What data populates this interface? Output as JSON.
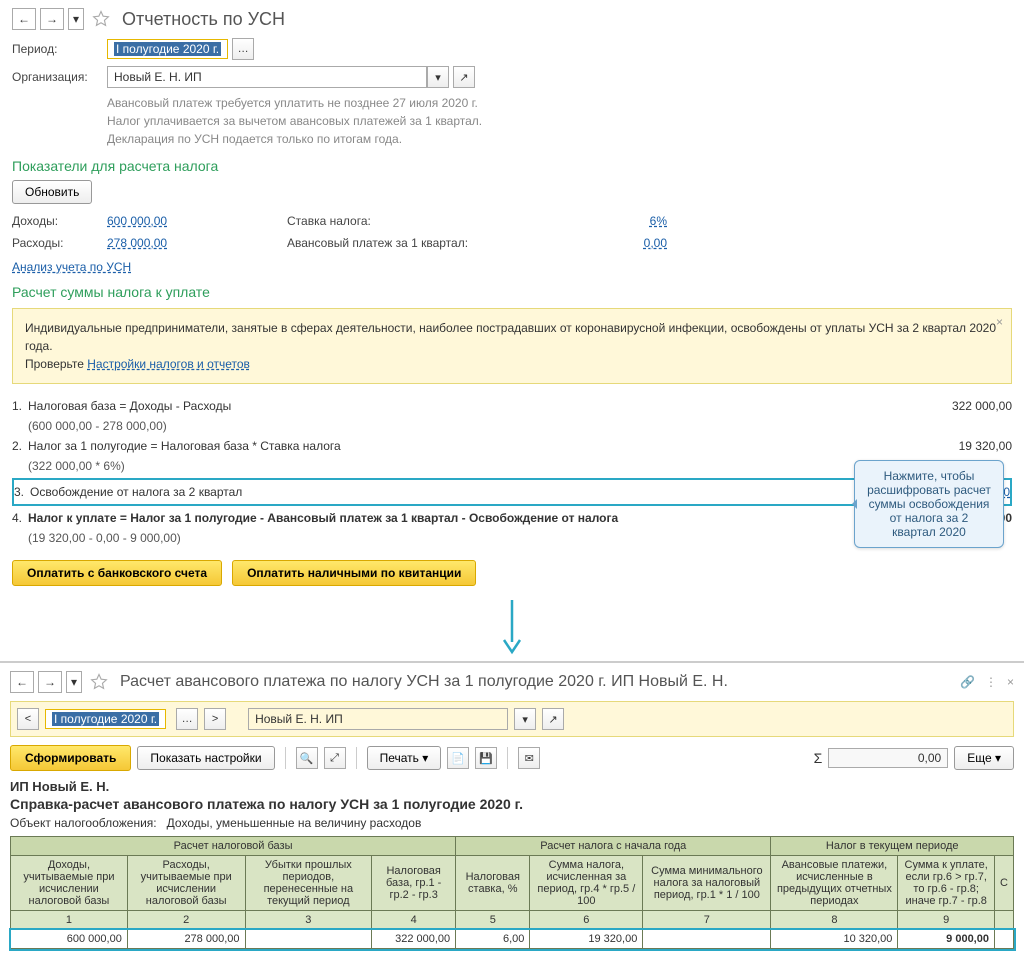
{
  "screen1": {
    "title": "Отчетность по УСН",
    "period_label": "Период:",
    "period_value": "I полугодие 2020 г.",
    "org_label": "Организация:",
    "org_value": "Новый Е. Н. ИП",
    "info_line1": "Авансовый платеж требуется уплатить не позднее 27 июля 2020 г.",
    "info_line2": "Налог уплачивается за вычетом авансовых платежей за 1 квартал.",
    "info_line3": "Декларация по УСН подается только по итогам года.",
    "section_indicators": "Показатели для расчета налога",
    "refresh_btn": "Обновить",
    "income_label": "Доходы:",
    "income_value": "600 000,00",
    "rate_label": "Ставка налога:",
    "rate_value": "6%",
    "expense_label": "Расходы:",
    "expense_value": "278 000,00",
    "advance_label": "Авансовый платеж за 1 квартал:",
    "advance_value": "0,00",
    "analysis_link": "Анализ учета по УСН",
    "section_calc": "Расчет суммы налога к уплате",
    "warning_line1": "Индивидуальные предприниматели, занятые в сферах деятельности, наиболее пострадавших от коронавирусной инфекции, освобождены от уплаты УСН за 2 квартал 2020 года.",
    "warning_line2_prefix": "Проверьте ",
    "warning_link": "Настройки налогов и отчетов",
    "calc": {
      "r1_text": "Налоговая база = Доходы - Расходы",
      "r1_sub": "(600 000,00 - 278 000,00)",
      "r1_amount": "322 000,00",
      "r2_text": "Налог за 1 полугодие = Налоговая база * Ставка налога",
      "r2_sub": "(322 000,00 * 6%)",
      "r2_amount": "19 320,00",
      "r3_text": "Освобождение от налога за 2 квартал",
      "r3_amount": "9 000,00",
      "r4_text": "Налог к уплате = Налог за 1 полугодие - Авансовый платеж за 1 квартал - Освобождение от налога",
      "r4_sub": "(19 320,00 - 0,00 - 9 000,00)",
      "r4_amount": "19 320,00"
    },
    "btn_pay_bank": "Оплатить с банковского счета",
    "btn_pay_cash": "Оплатить наличными по квитанции",
    "callout": "Нажмите, чтобы расшифровать расчет суммы освобождения от налога за 2 квартал 2020"
  },
  "screen2": {
    "title": "Расчет  авансового платежа по налогу УСН за 1 полугодие 2020 г. ИП Новый Е. Н.",
    "period_value": "I полугодие 2020 г.",
    "org_value": "Новый Е. Н. ИП",
    "btn_form": "Сформировать",
    "btn_settings": "Показать настройки",
    "btn_print": "Печать",
    "sum_sign": "Σ",
    "sum_value": "0,00",
    "btn_more": "Еще",
    "report": {
      "org": "ИП Новый Е. Н.",
      "title": "Справка-расчет авансового платежа по налогу УСН за 1 полугодие 2020 г.",
      "obj_label": "Объект налогообложения:",
      "obj_value": "Доходы, уменьшенные на величину расходов"
    },
    "table": {
      "group1": "Расчет налоговой базы",
      "group2": "Расчет налога с начала года",
      "group3": "Налог в текущем периоде",
      "h1": "Доходы, учитываемые при исчислении налоговой базы",
      "h2": "Расходы, учитываемые при исчислении налоговой базы",
      "h3": "Убытки прошлых периодов, перенесенные на текущий период",
      "h4": "Налоговая база, гр.1 - гр.2 - гр.3",
      "h5": "Налоговая ставка, %",
      "h6": "Сумма налога, исчисленная за период, гр.4 * гр.5 / 100",
      "h7": "Сумма минимального налога за налоговый период, гр.1 * 1 / 100",
      "h8": "Авансовые платежи, исчисленные в предыдущих отчетных периодах",
      "h9": "Сумма к уплате, если гр.6 > гр.7, то гр.6 - гр.8; иначе гр.7 - гр.8",
      "h10": "С",
      "n1": "1",
      "n2": "2",
      "n3": "3",
      "n4": "4",
      "n5": "5",
      "n6": "6",
      "n7": "7",
      "n8": "8",
      "n9": "9",
      "d1": "600 000,00",
      "d2": "278 000,00",
      "d3": "",
      "d4": "322 000,00",
      "d5": "6,00",
      "d6": "19 320,00",
      "d7": "",
      "d8": "10 320,00",
      "d9": "9 000,00"
    }
  }
}
